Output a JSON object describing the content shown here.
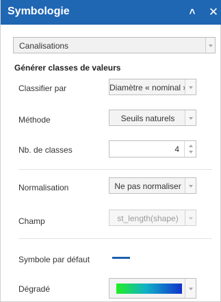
{
  "header": {
    "title": "Symbologie",
    "collapse_glyph": "≽",
    "close_glyph": "✕"
  },
  "layer": {
    "selected": "Canalisations"
  },
  "section": {
    "title": "Générer classes de valeurs"
  },
  "fields": {
    "classify_by": {
      "label": "Classifier par",
      "value": "Diamètre « nominal »"
    },
    "method": {
      "label": "Méthode",
      "value": "Seuils naturels"
    },
    "num_classes": {
      "label": "Nb. de classes",
      "value": "4"
    },
    "normalization": {
      "label": "Normalisation",
      "value": "Ne pas normaliser"
    },
    "field": {
      "label": "Champ",
      "value": "st_length(shape)",
      "disabled": true
    },
    "default_symbol": {
      "label": "Symbole par défaut",
      "color": "#1c5fae"
    },
    "gradient": {
      "label": "Dégradé",
      "colors": [
        "#22ee22",
        "#10b0c8",
        "#1133cc"
      ]
    }
  },
  "colors": {
    "header_bg": "#1f66b3",
    "header_text": "#ffffff"
  },
  "icons": {
    "collapse": "double-chevron-up-icon",
    "close": "close-icon",
    "dropdown": "chevron-down-icon",
    "spinner_up": "triangle-up-icon",
    "spinner_down": "triangle-down-icon"
  }
}
